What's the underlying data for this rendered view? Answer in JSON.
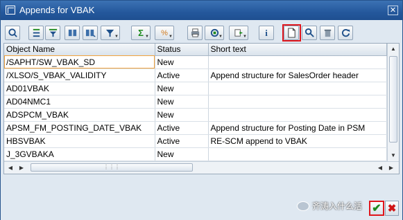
{
  "window": {
    "title": "Appends for VBAK"
  },
  "grid": {
    "columns": [
      "Object Name",
      "Status",
      "Short text"
    ],
    "rows": [
      {
        "name": "/SAPHT/SW_VBAK_SD",
        "status": "New",
        "text": ""
      },
      {
        "name": "/XLSO/S_VBAK_VALIDITY",
        "status": "Active",
        "text": "Append structure for SalesOrder header"
      },
      {
        "name": "AD01VBAK",
        "status": "New",
        "text": ""
      },
      {
        "name": "AD04NMC1",
        "status": "New",
        "text": ""
      },
      {
        "name": "ADSPCM_VBAK",
        "status": "New",
        "text": ""
      },
      {
        "name": "APSM_FM_POSTING_DATE_VBAK",
        "status": "Active",
        "text": "Append structure for Posting Date in PSM"
      },
      {
        "name": "HBSVBAK",
        "status": "Active",
        "text": "RE-SCM  append to VBAK"
      },
      {
        "name": "J_3GVBAKA",
        "status": "New",
        "text": ""
      }
    ]
  },
  "watermark": "齐涛入什么活",
  "icons": {
    "toolbar": [
      "details-icon",
      "sort-ascending-icon",
      "filter-icon",
      "find-icon",
      "find-next-icon",
      "set-filter-icon",
      "sum-icon",
      "subtotal-icon",
      "print-icon",
      "views-icon",
      "export-icon",
      "info-icon",
      "create-icon",
      "where-used-icon",
      "delete-icon",
      "refresh-icon"
    ],
    "ok": "checkmark-icon",
    "cancel": "cancel-icon"
  }
}
